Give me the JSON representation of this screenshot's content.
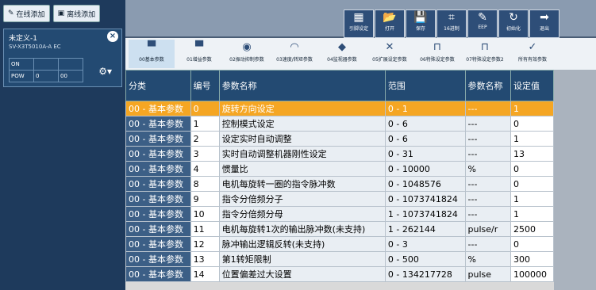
{
  "left": {
    "online_add": "在线添加",
    "offline_add": "离线添加",
    "device_name": "未定义-1",
    "device_model": "SV-X3T5010A-A EC",
    "status": [
      [
        "ON",
        "",
        ""
      ],
      [
        "POW",
        "0",
        "00"
      ]
    ]
  },
  "toolbar": [
    {
      "label": "引脚设定",
      "icon": "grid-icon"
    },
    {
      "label": "打开",
      "icon": "open-icon"
    },
    {
      "label": "保存",
      "icon": "save-icon"
    },
    {
      "label": "16进制",
      "icon": "hex-icon"
    },
    {
      "label": "EEP",
      "icon": "eep-icon"
    },
    {
      "label": "初始化",
      "icon": "init-icon"
    },
    {
      "label": "退出",
      "icon": "exit-icon"
    }
  ],
  "tabs": [
    "00基本参数",
    "01增益参数",
    "02振动抑制参数",
    "03速度/转矩参数",
    "04监视器参数",
    "05扩展设定参数",
    "06特殊设定参数",
    "07特殊设定参数2",
    "所有有效参数"
  ],
  "table": {
    "headers": [
      "分类",
      "编号",
      "参数名称",
      "范围",
      "参数名称",
      "设定值"
    ],
    "rows": [
      [
        "00 - 基本参数",
        "0",
        "旋转方向设定",
        "0 - 1",
        "---",
        "1"
      ],
      [
        "00 - 基本参数",
        "1",
        "控制模式设定",
        "0 - 6",
        "---",
        "0"
      ],
      [
        "00 - 基本参数",
        "2",
        "设定实时自动调整",
        "0 - 6",
        "---",
        "1"
      ],
      [
        "00 - 基本参数",
        "3",
        "实时自动调整机器刚性设定",
        "0 - 31",
        "---",
        "13"
      ],
      [
        "00 - 基本参数",
        "4",
        "惯量比",
        "0 - 10000",
        "%",
        "0"
      ],
      [
        "00 - 基本参数",
        "8",
        "电机每旋转一圈的指令脉冲数",
        "0 - 1048576",
        "---",
        "0"
      ],
      [
        "00 - 基本参数",
        "9",
        "指令分倍频分子",
        "0 - 1073741824",
        "---",
        "1"
      ],
      [
        "00 - 基本参数",
        "10",
        "指令分倍频分母",
        "1 - 1073741824",
        "---",
        "1"
      ],
      [
        "00 - 基本参数",
        "11",
        "电机每旋转1次的输出脉冲数(未支持)",
        "1 - 262144",
        "pulse/r",
        "2500"
      ],
      [
        "00 - 基本参数",
        "12",
        "脉冲输出逻辑反转(未支持)",
        "0 - 3",
        "---",
        "0"
      ],
      [
        "00 - 基本参数",
        "13",
        "第1转矩限制",
        "0 - 500",
        "%",
        "300"
      ],
      [
        "00 - 基本参数",
        "14",
        "位置偏差过大设置",
        "0 - 134217728",
        "pulse",
        "100000"
      ]
    ]
  }
}
